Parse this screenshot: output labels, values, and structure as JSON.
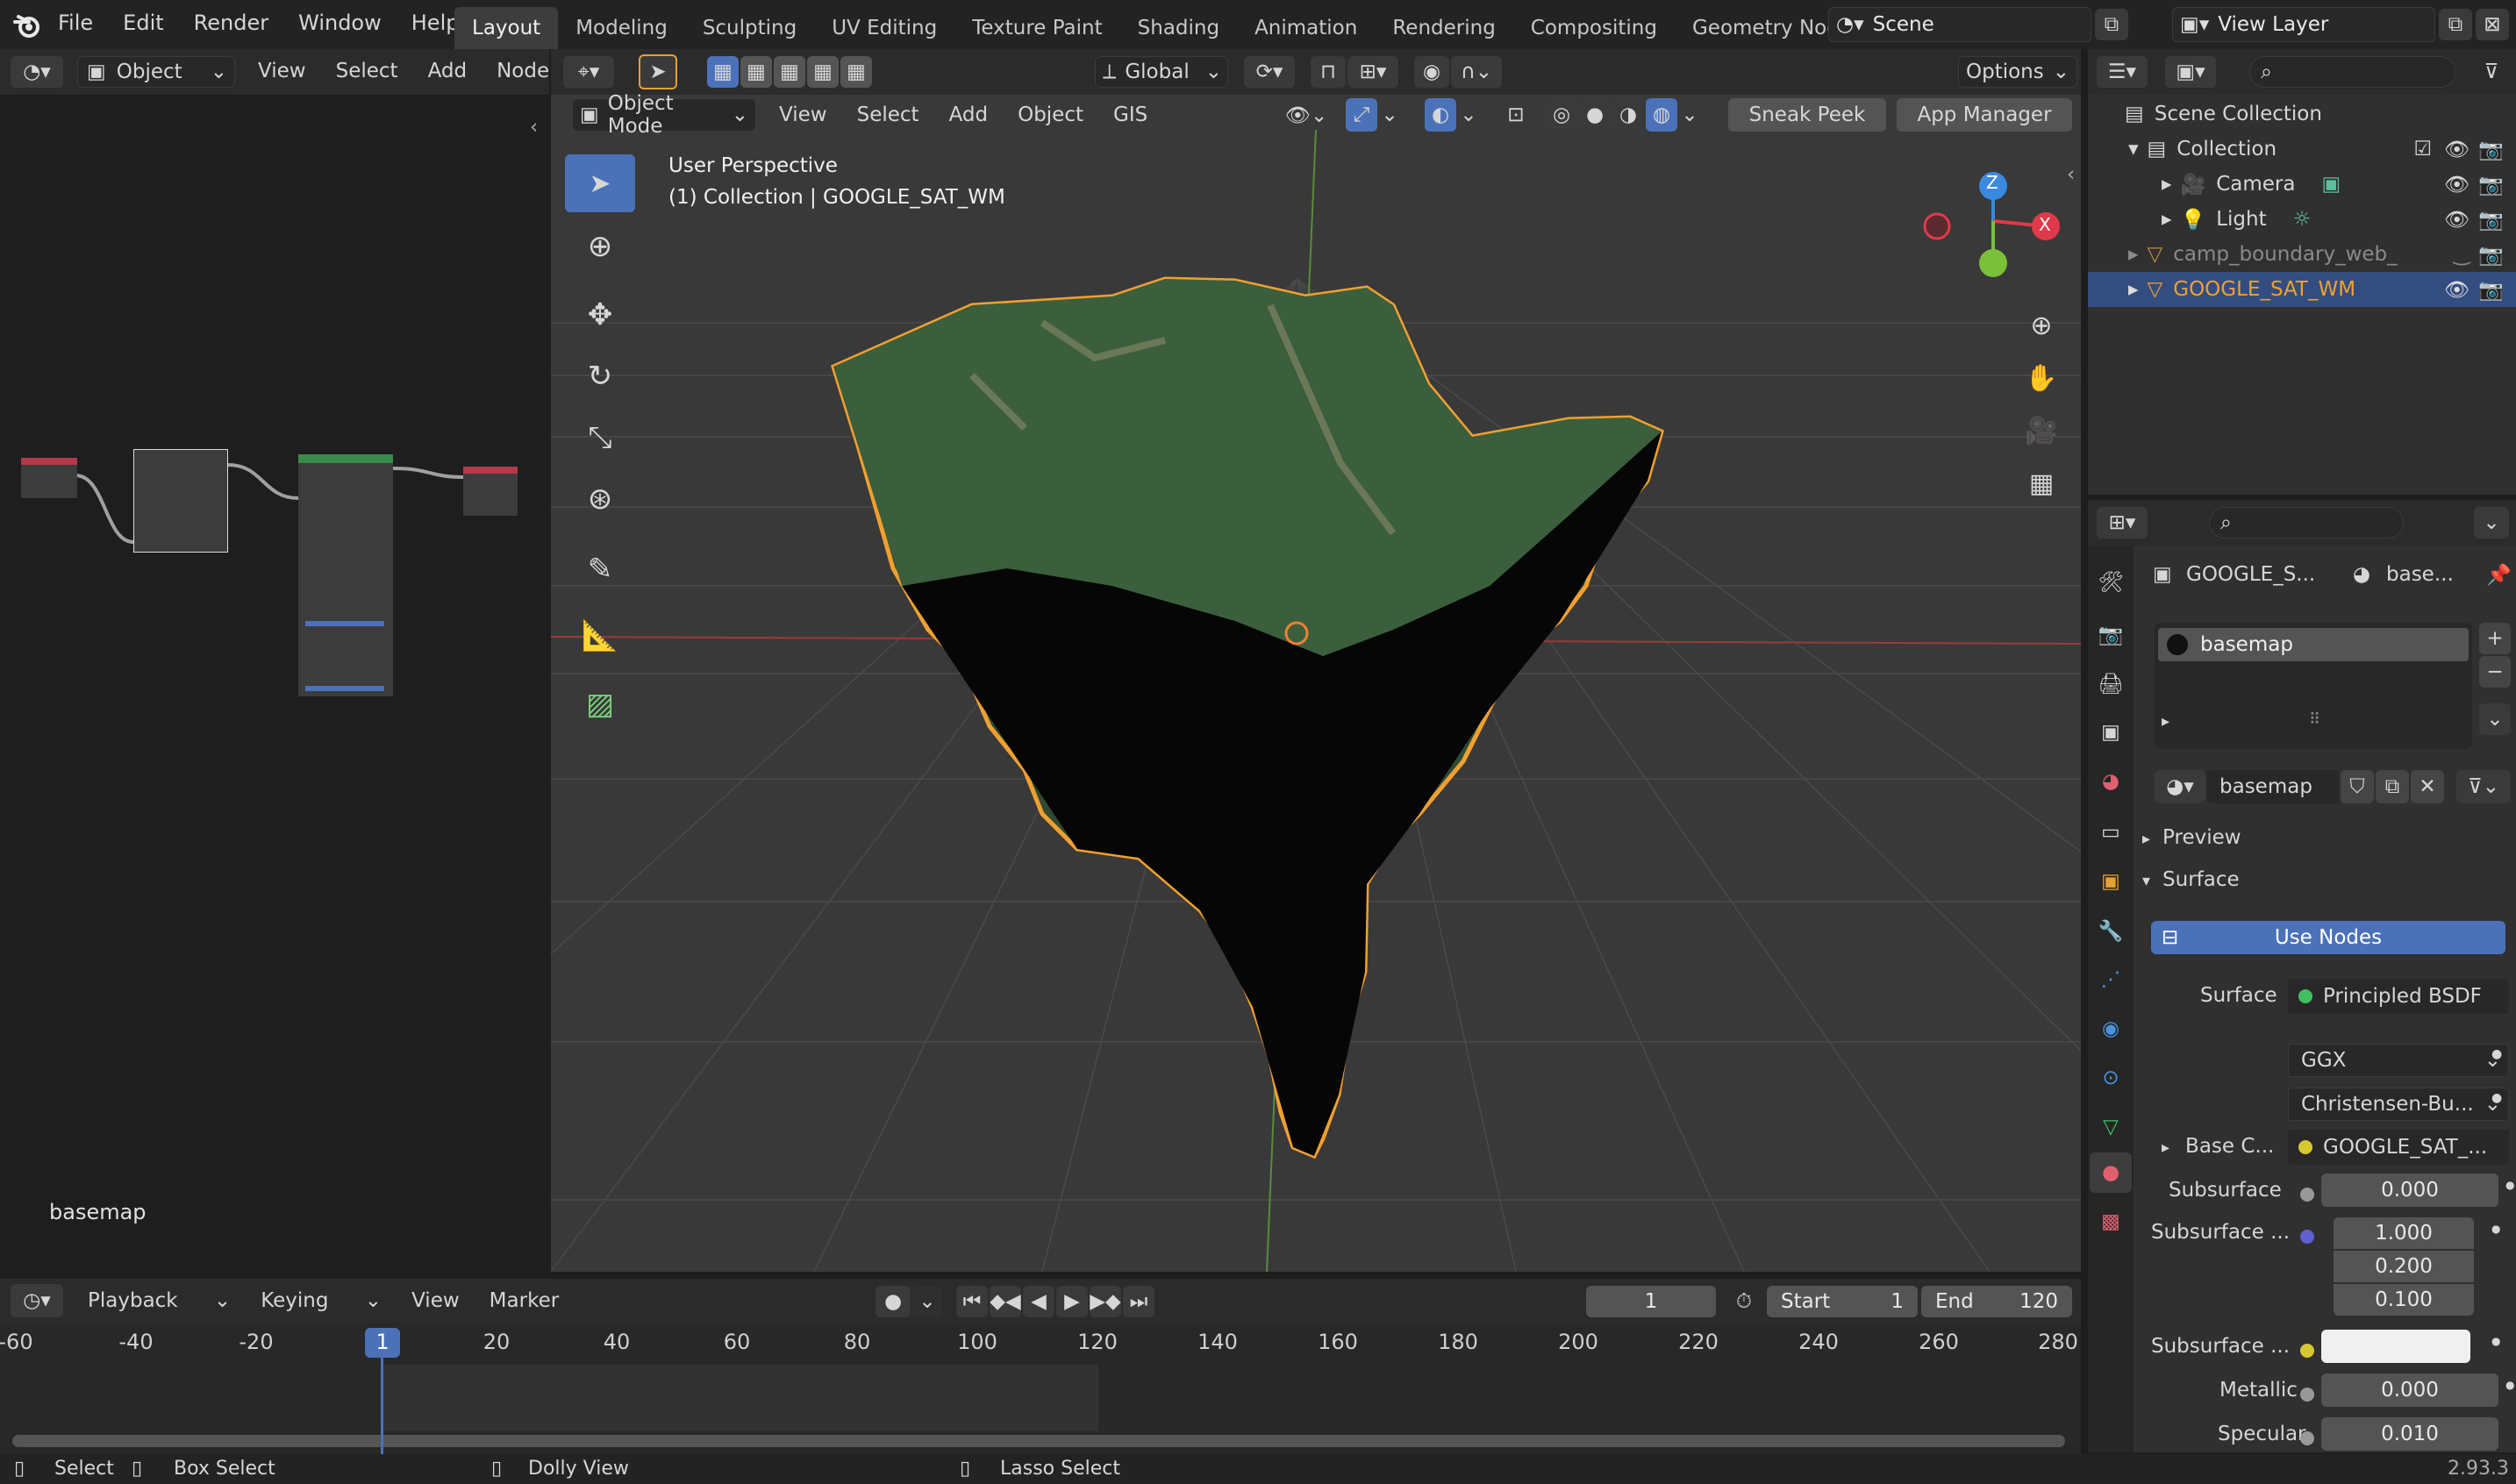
{
  "topbar": {
    "menus": [
      "File",
      "Edit",
      "Render",
      "Window",
      "Help"
    ],
    "workspaces": [
      "Layout",
      "Modeling",
      "Sculpting",
      "UV Editing",
      "Texture Paint",
      "Shading",
      "Animation",
      "Rendering",
      "Compositing",
      "Geometry Nodes"
    ],
    "active_workspace": "Layout",
    "scene": "Scene",
    "view_layer": "View Layer"
  },
  "node_editor": {
    "type_label": "Object",
    "menus": [
      "View",
      "Select",
      "Add",
      "Node"
    ],
    "material_name": "basemap"
  },
  "viewport": {
    "header": {
      "orientation": "Global",
      "options": "Options"
    },
    "header2": {
      "mode": "Object Mode",
      "menus": [
        "View",
        "Select",
        "Add",
        "Object",
        "GIS"
      ],
      "sneak_peek": "Sneak Peek",
      "app_manager": "App Manager"
    },
    "overlay": {
      "line1": "User Perspective",
      "line2": "(1) Collection | GOOGLE_SAT_WM"
    },
    "gizmo": {
      "z": "Z",
      "x": "X"
    }
  },
  "outliner": {
    "items": [
      {
        "name": "Scene Collection"
      },
      {
        "name": "Collection"
      },
      {
        "name": "Camera"
      },
      {
        "name": "Light"
      },
      {
        "name": "camp_boundary_web_"
      },
      {
        "name": "GOOGLE_SAT_WM"
      }
    ]
  },
  "properties": {
    "object_name": "GOOGLE_S...",
    "material_short": "base...",
    "slot": "basemap",
    "material": "basemap",
    "sections": {
      "preview": "Preview",
      "surface": "Surface"
    },
    "use_nodes": "Use Nodes",
    "rows": {
      "surface_label": "Surface",
      "surface_value": "Principled BSDF",
      "distribution": "GGX",
      "subsurface_method": "Christensen-Bu...",
      "base_color_label": "Base C...",
      "base_color_value": "GOOGLE_SAT_...",
      "subsurface_label": "Subsurface",
      "subsurface_value": "0.000",
      "subsurface_radius_label": "Subsurface ...",
      "radius": [
        "1.000",
        "0.200",
        "0.100"
      ],
      "subsurface_color_label": "Subsurface ...",
      "metallic_label": "Metallic",
      "metallic_value": "0.000",
      "specular_label": "Specular",
      "specular_value": "0.010"
    }
  },
  "timeline": {
    "menus": [
      "Playback",
      "Keying",
      "View",
      "Marker"
    ],
    "current_frame": "1",
    "start_label": "Start",
    "start": "1",
    "end_label": "End",
    "end": "120",
    "ticks": [
      "-60",
      "-40",
      "-20",
      "1",
      "20",
      "40",
      "60",
      "80",
      "100",
      "120",
      "140",
      "160",
      "180",
      "200",
      "220",
      "240",
      "260",
      "280"
    ]
  },
  "statusbar": {
    "select": "Select",
    "box_select": "Box Select",
    "dolly": "Dolly View",
    "lasso": "Lasso Select",
    "version": "2.93.3"
  }
}
